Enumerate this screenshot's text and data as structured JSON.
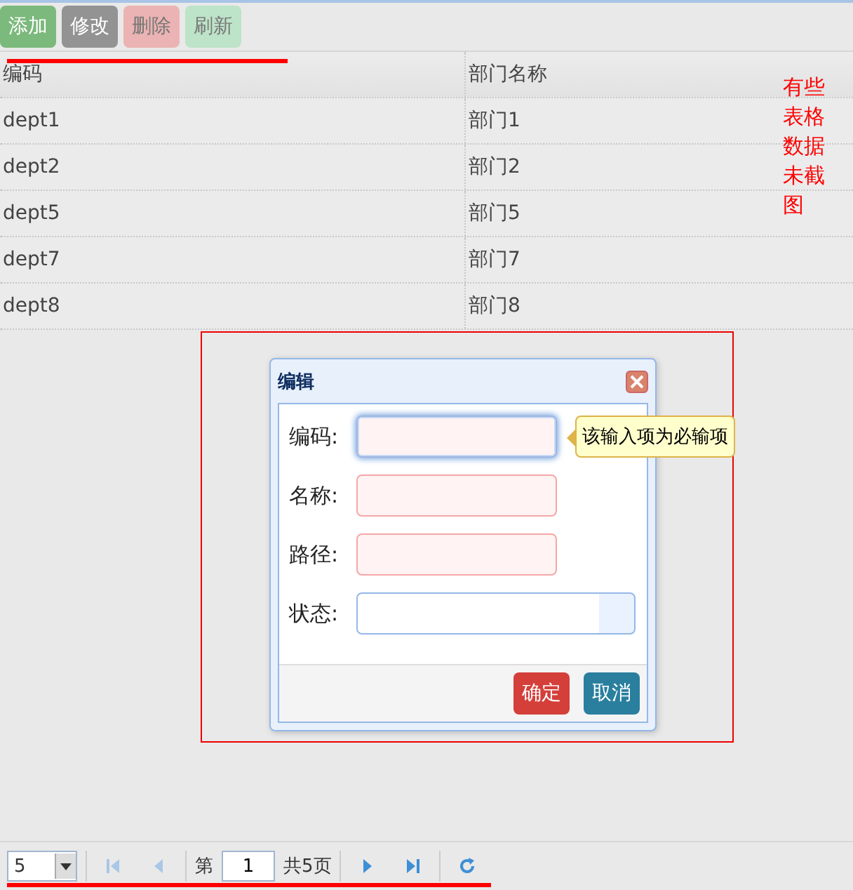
{
  "toolbar": {
    "buttons": [
      {
        "label": "添加",
        "kind": "add"
      },
      {
        "label": "修改",
        "kind": "edit"
      },
      {
        "label": "删除",
        "kind": "delete"
      },
      {
        "label": "刷新",
        "kind": "refresh"
      }
    ]
  },
  "table": {
    "columns": [
      "编码",
      "部门名称"
    ],
    "rows": [
      [
        "dept1",
        "部门1"
      ],
      [
        "dept2",
        "部门2"
      ],
      [
        "dept5",
        "部门5"
      ],
      [
        "dept7",
        "部门7"
      ],
      [
        "dept8",
        "部门8"
      ]
    ]
  },
  "annotation": {
    "note": "有些表格数据未截图"
  },
  "dialog": {
    "title": "编辑",
    "fields": [
      {
        "label": "编码:",
        "kind": "text",
        "invalid": true,
        "focused": true
      },
      {
        "label": "名称:",
        "kind": "text",
        "invalid": true,
        "focused": false
      },
      {
        "label": "路径:",
        "kind": "text",
        "invalid": true,
        "focused": false
      },
      {
        "label": "状态:",
        "kind": "combo",
        "invalid": false,
        "focused": false
      }
    ],
    "tooltip": "该输入项为必输项",
    "buttons": [
      {
        "label": "确定",
        "kind": "ok"
      },
      {
        "label": "取消",
        "kind": "cancel"
      }
    ]
  },
  "pagination": {
    "page_size": "5",
    "page_label": "第",
    "page": "1",
    "total": "共5页"
  }
}
